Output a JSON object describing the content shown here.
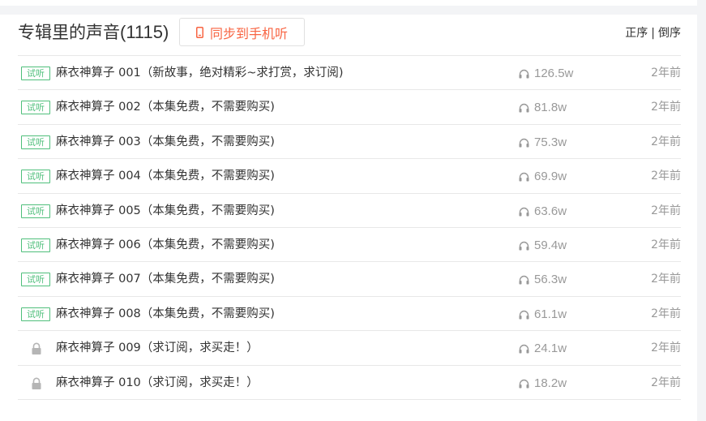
{
  "album": {
    "title": "专辑里的声音",
    "count": "(1115)",
    "sync_label": "同步到手机听",
    "sort_asc": "正序",
    "sort_sep": "|",
    "sort_desc": "倒序"
  },
  "colors": {
    "accent": "#f86442",
    "trial_green": "#4fbf7b",
    "text": "#333333",
    "muted": "#999999"
  },
  "tracks": [
    {
      "title": "麻衣神算子 001（新故事，绝对精彩~求打赏，求订阅)",
      "plays": "126.5w",
      "date": "2年前",
      "trial": true,
      "trial_label": "试听"
    },
    {
      "title": "麻衣神算子 002（本集免费，不需要购买)",
      "plays": "81.8w",
      "date": "2年前",
      "trial": true,
      "trial_label": "试听"
    },
    {
      "title": "麻衣神算子 003（本集免费，不需要购买)",
      "plays": "75.3w",
      "date": "2年前",
      "trial": true,
      "trial_label": "试听"
    },
    {
      "title": "麻衣神算子 004（本集免费，不需要购买)",
      "plays": "69.9w",
      "date": "2年前",
      "trial": true,
      "trial_label": "试听"
    },
    {
      "title": "麻衣神算子 005（本集免费，不需要购买)",
      "plays": "63.6w",
      "date": "2年前",
      "trial": true,
      "trial_label": "试听"
    },
    {
      "title": "麻衣神算子 006（本集免费，不需要购买)",
      "plays": "59.4w",
      "date": "2年前",
      "trial": true,
      "trial_label": "试听"
    },
    {
      "title": "麻衣神算子 007（本集免费，不需要购买)",
      "plays": "56.3w",
      "date": "2年前",
      "trial": true,
      "trial_label": "试听"
    },
    {
      "title": "麻衣神算子 008（本集免费，不需要购买)",
      "plays": "61.1w",
      "date": "2年前",
      "trial": true,
      "trial_label": "试听"
    },
    {
      "title": "麻衣神算子 009（求订阅，求买走！）",
      "plays": "24.1w",
      "date": "2年前",
      "trial": false,
      "icon": "lock-icon"
    },
    {
      "title": "麻衣神算子 010（求订阅，求买走！）",
      "plays": "18.2w",
      "date": "2年前",
      "trial": false,
      "icon": "lock-icon"
    }
  ]
}
